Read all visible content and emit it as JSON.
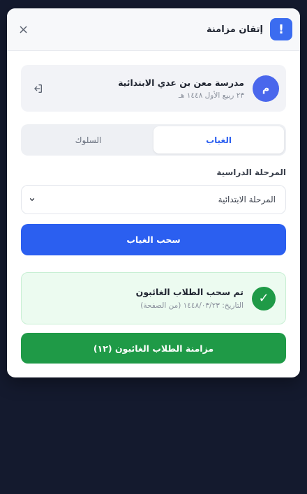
{
  "header": {
    "logo_text": "!",
    "title": "إتقان مزامنة",
    "close_label": "×"
  },
  "school": {
    "avatar_letter": "م",
    "name": "مدرسة معن بن عدي الابتدائية",
    "date": "٢٣ ربيع الأول ١٤٤٨ هـ"
  },
  "tabs": [
    {
      "label": "الغياب",
      "active": true
    },
    {
      "label": "السلوك",
      "active": false
    }
  ],
  "stage": {
    "label": "المرحلة الدراسية",
    "selected": "المرحلة الابتدائية"
  },
  "fetch_button": "سحب الغياب",
  "result": {
    "heading": "تم سحب الطلاب الغائبون",
    "subtext": "التاريخ: ١٤٤٨/٠٣/٢٣ (من الصفحة)"
  },
  "sync_button": "مزامنة الطلاب الغائبون (١٢)",
  "colors": {
    "primary": "#2b5ff0",
    "success": "#1f9a47",
    "background": "#141a2e"
  }
}
